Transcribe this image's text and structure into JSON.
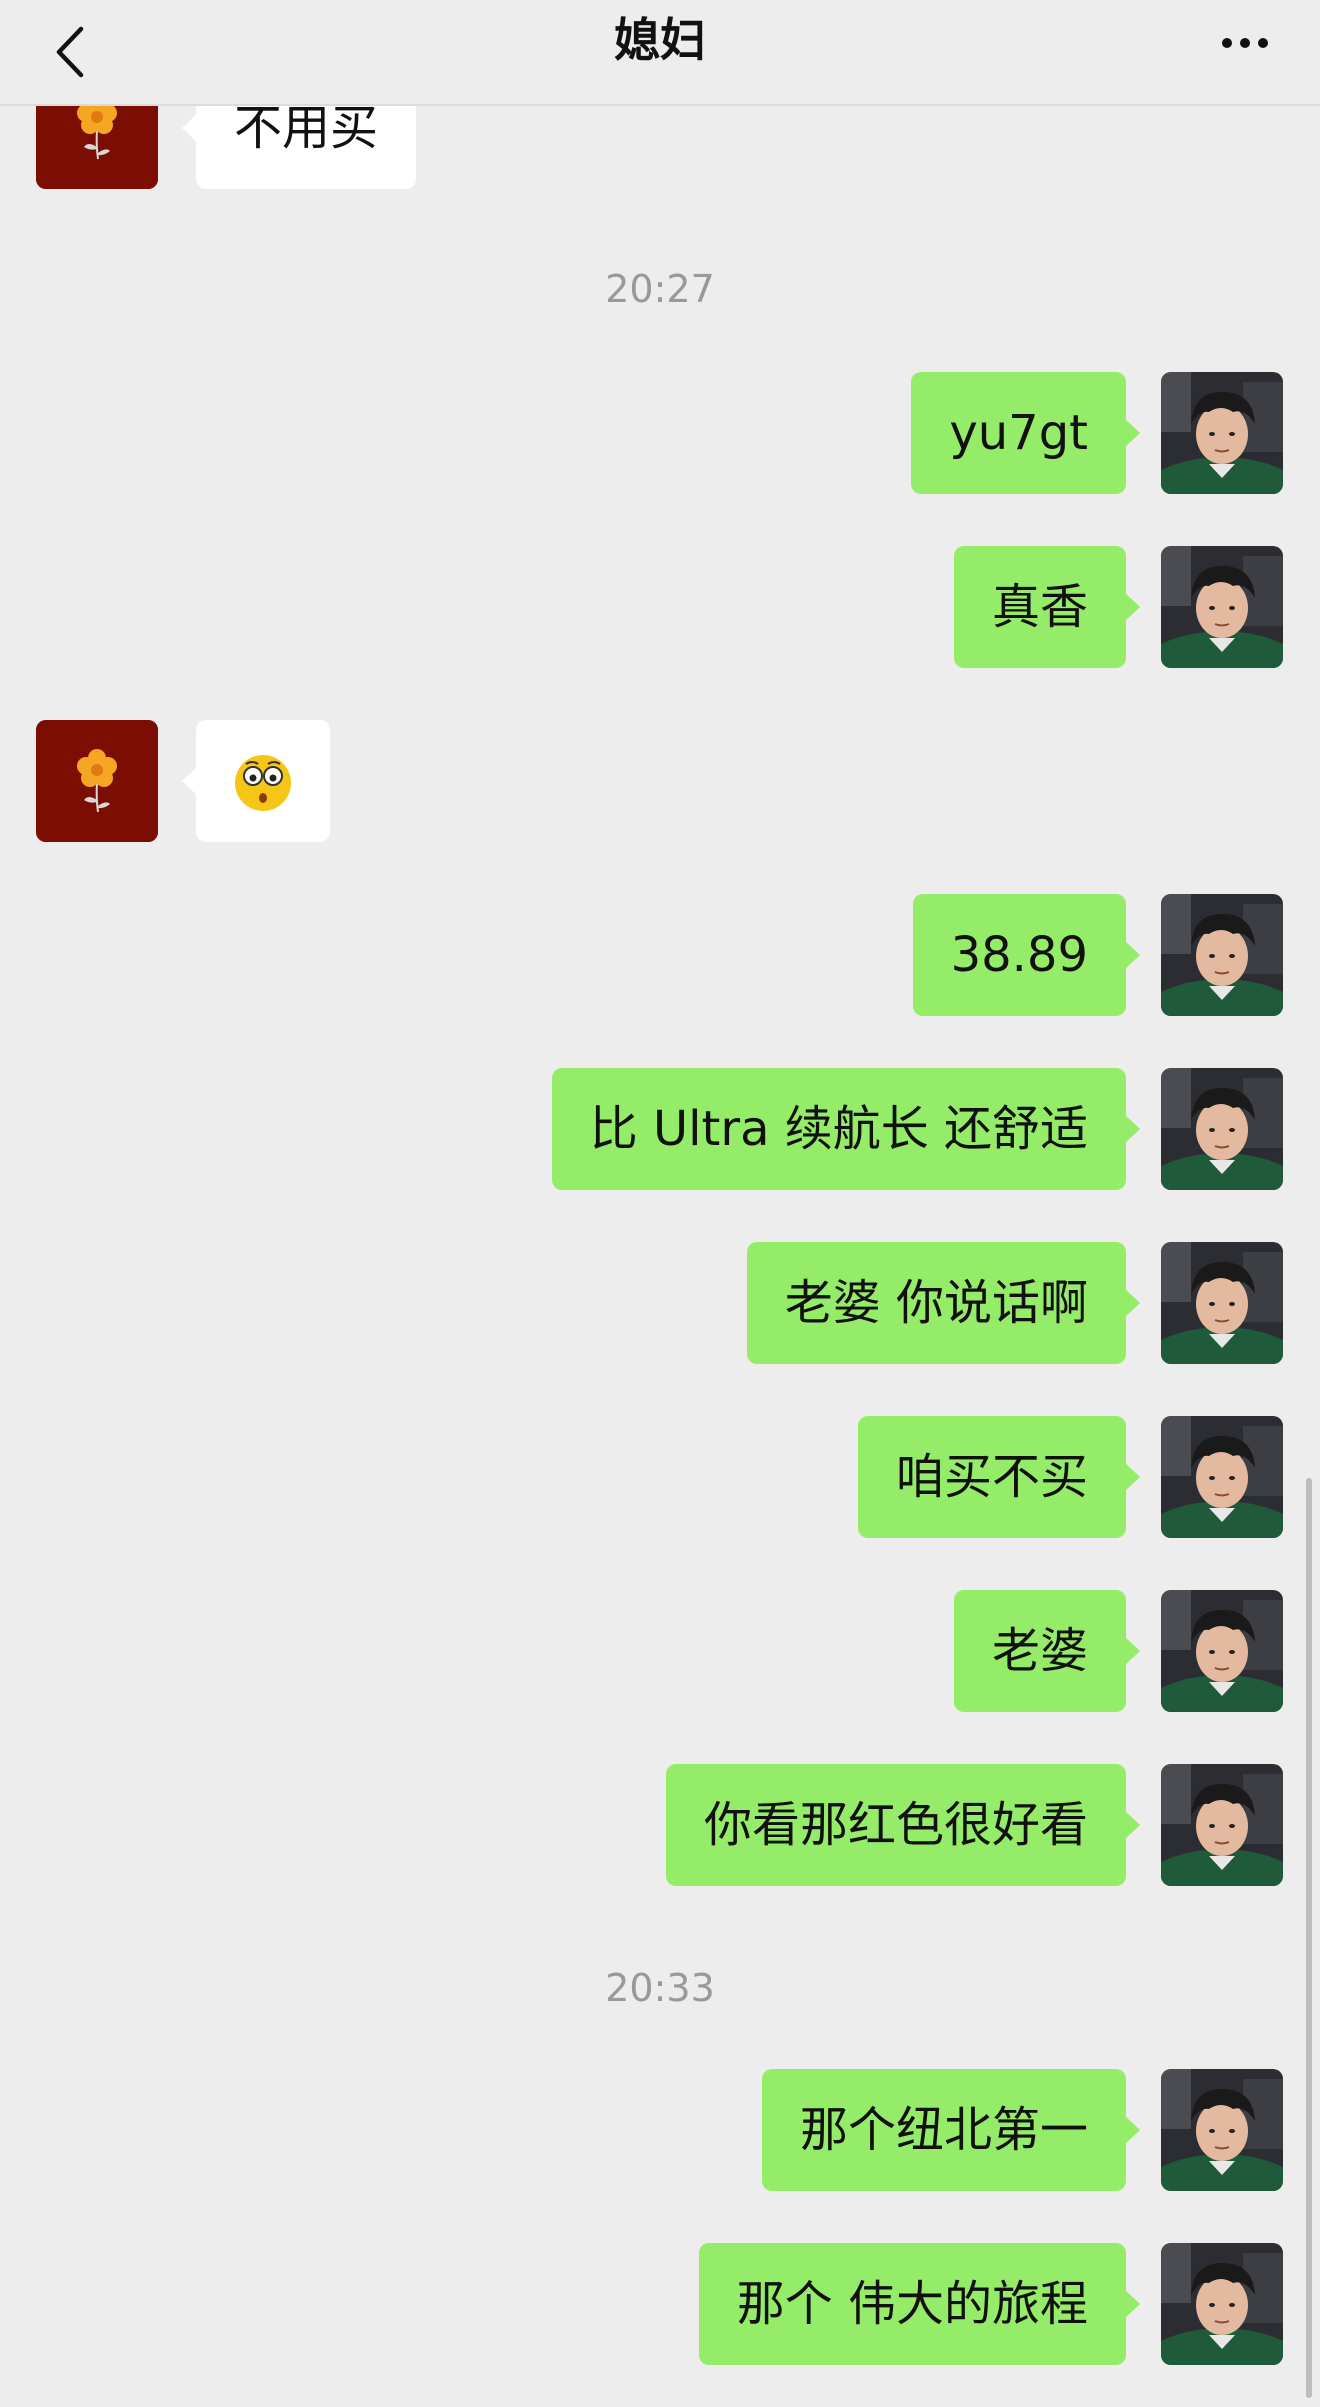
{
  "header": {
    "title": "媳妇"
  },
  "icons": {
    "back": "chevron-left-icon",
    "more": "ellipsis-icon",
    "self_avatar": "user-photo",
    "other_avatar": "flower-icon",
    "sticker": "emoji-surprised-face"
  },
  "colors": {
    "self_bubble": "#95ec69",
    "other_bubble": "#ffffff",
    "background": "#ededed",
    "other_avatar_bg": "#7b0d02"
  },
  "messages": [
    {
      "sender": "other",
      "text": "不用买"
    },
    {
      "time": "20:27"
    },
    {
      "sender": "self",
      "text": "yu7gt"
    },
    {
      "sender": "self",
      "text": "真香"
    },
    {
      "sender": "other",
      "sticker": "surprised-face-emoji"
    },
    {
      "sender": "self",
      "text": "38.89"
    },
    {
      "sender": "self",
      "text": "比 Ultra 续航长 还舒适"
    },
    {
      "sender": "self",
      "text": "老婆 你说话啊"
    },
    {
      "sender": "self",
      "text": "咱买不买"
    },
    {
      "sender": "self",
      "text": "老婆"
    },
    {
      "sender": "self",
      "text": "你看那红色很好看"
    },
    {
      "time": "20:33"
    },
    {
      "sender": "self",
      "text": "那个纽北第一"
    },
    {
      "sender": "self",
      "text": "那个 伟大的旅程"
    }
  ]
}
